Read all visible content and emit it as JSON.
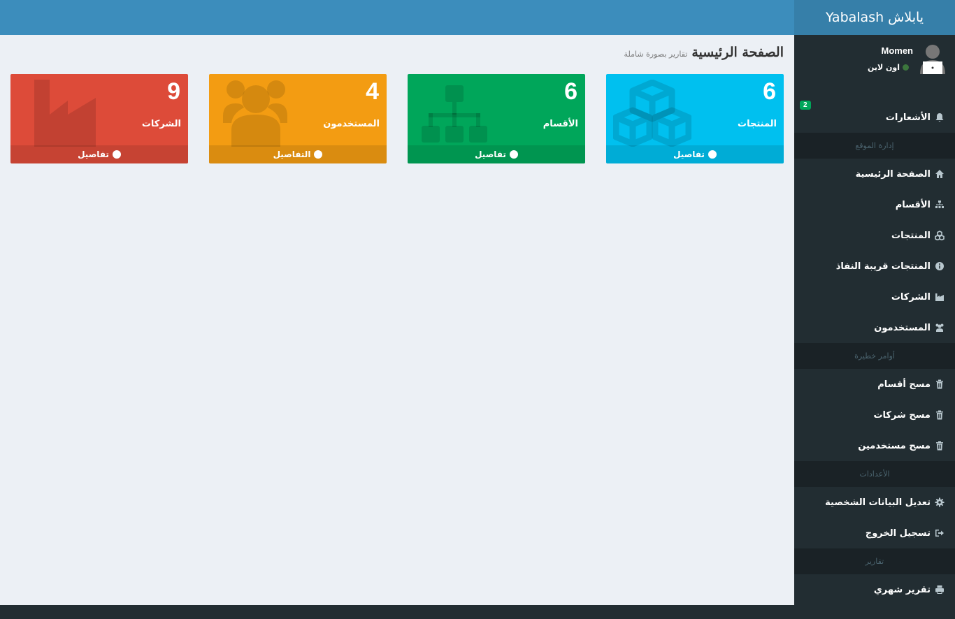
{
  "brand": {
    "title": "يابلاش Yabalash"
  },
  "page": {
    "title": "الصفحة الرئيسية",
    "subtitle": "تقارير بصورة شاملة"
  },
  "user": {
    "name": "Momen",
    "status": "اون لاين"
  },
  "boxes": [
    {
      "count": "9",
      "label": "الشركات",
      "more": "تفاصيل",
      "color": "#dd4b39",
      "icon": "industry-icon"
    },
    {
      "count": "4",
      "label": "المستخدمون",
      "more": "التفاصيل",
      "color": "#f39c12",
      "icon": "users-icon"
    },
    {
      "count": "6",
      "label": "الأقسام",
      "more": "تفاصيل",
      "color": "#00a65a",
      "icon": "sitemap-icon"
    },
    {
      "count": "6",
      "label": "المنتجات",
      "more": "تفاصيل",
      "color": "#00c0ef",
      "icon": "cubes-icon"
    }
  ],
  "sidebar": {
    "notifications": {
      "label": "الأشعارات",
      "badge": "2",
      "icon": "bell-icon"
    },
    "sections": [
      {
        "header": "إدارة الموقع",
        "items": [
          {
            "label": "الصفحة الرئيسية",
            "icon": "home-icon"
          },
          {
            "label": "الأقسام",
            "icon": "sitemap-icon"
          },
          {
            "label": "المنتجات",
            "icon": "cubes-icon"
          },
          {
            "label": "المنتجات قريبة النفاذ",
            "icon": "info-icon"
          },
          {
            "label": "الشركات",
            "icon": "industry-icon"
          },
          {
            "label": "المستخدمون",
            "icon": "users-icon"
          }
        ]
      },
      {
        "header": "أوامر خطيرة",
        "items": [
          {
            "label": "مسح أقسام",
            "icon": "trash-icon"
          },
          {
            "label": "مسح شركات",
            "icon": "trash-icon"
          },
          {
            "label": "مسح مستخدمين",
            "icon": "trash-icon"
          }
        ]
      },
      {
        "header": "الأعدادات",
        "items": [
          {
            "label": "تعديل البيانات الشخصية",
            "icon": "gear-icon"
          },
          {
            "label": "تسجيل الخروج",
            "icon": "sign-out-icon"
          }
        ]
      },
      {
        "header": "تقارير",
        "items": [
          {
            "label": "تقرير شهري",
            "icon": "print-icon"
          }
        ]
      }
    ]
  }
}
